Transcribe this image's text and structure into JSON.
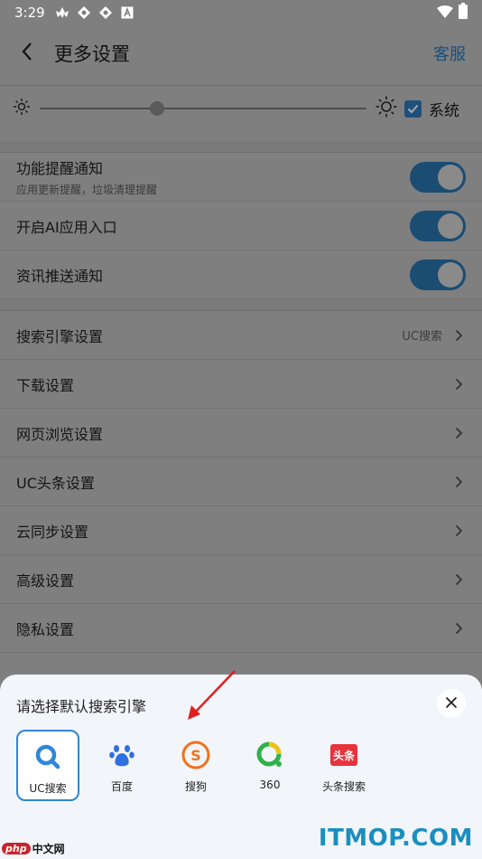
{
  "status_bar": {
    "time": "3:29",
    "notification_icons": [
      "huawei-logo-icon",
      "pinwheel-icon",
      "pinwheel-icon",
      "a-box-icon"
    ],
    "right_icons": [
      "wifi-icon",
      "battery-icon"
    ]
  },
  "header": {
    "back_icon": "chevron-left-icon",
    "title": "更多设置",
    "service_label": "客服"
  },
  "brightness": {
    "min_icon": "sun-small-icon",
    "max_icon": "sun-large-icon",
    "level": 0.36,
    "system_checked": true,
    "system_label": "系统"
  },
  "toggles": [
    {
      "label": "功能提醒通知",
      "sub": "应用更新提醒，垃圾清理提醒",
      "on": true
    },
    {
      "label": "开启AI应用入口",
      "on": true
    },
    {
      "label": "资讯推送通知",
      "on": true
    }
  ],
  "settings": [
    {
      "label": "搜索引擎设置",
      "value": "UC搜索"
    },
    {
      "label": "下载设置"
    },
    {
      "label": "网页浏览设置"
    },
    {
      "label": "UC头条设置"
    },
    {
      "label": "云同步设置"
    },
    {
      "label": "高级设置"
    },
    {
      "label": "隐私设置"
    }
  ],
  "sheet": {
    "title": "请选择默认搜索引擎",
    "close_icon": "close-icon",
    "engines": [
      {
        "name": "UC搜索",
        "icon": "uc-search-icon",
        "selected": true,
        "color": "#2f86d8"
      },
      {
        "name": "百度",
        "icon": "baidu-paw-icon",
        "selected": false,
        "color": "#2f6fe0"
      },
      {
        "name": "搜狗",
        "icon": "sogou-icon",
        "selected": false,
        "color": "#f2711c"
      },
      {
        "name": "360",
        "icon": "360-icon",
        "selected": false,
        "color": "#2fb24a"
      },
      {
        "name": "头条搜索",
        "icon": "toutiao-icon",
        "selected": false,
        "color": "#e8323c",
        "logo_text": "头条"
      }
    ]
  },
  "watermarks": {
    "php_badge": "php",
    "php_cn": "中文网",
    "itmop": "ITMOP.COM"
  },
  "colors": {
    "accent": "#1b4c72",
    "overlay": "#7f7f7f",
    "sheet_bg": "#f2f5f9",
    "selected_border": "#2f86d8"
  }
}
